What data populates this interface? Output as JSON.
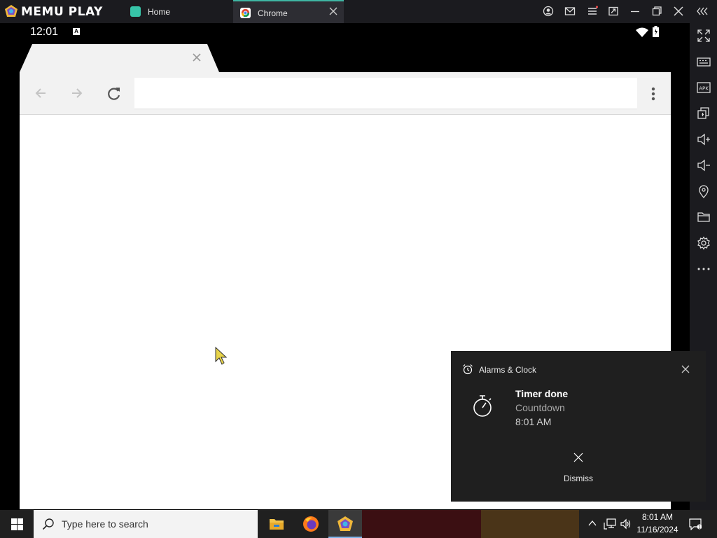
{
  "emulator": {
    "brand": "MEMU PLAY",
    "tabs": [
      {
        "label": "Home"
      },
      {
        "label": "Chrome"
      }
    ]
  },
  "android": {
    "clock": "12:01",
    "badge": "A"
  },
  "notification": {
    "app": "Alarms & Clock",
    "title": "Timer done",
    "subtitle": "Countdown",
    "time": "8:01 AM",
    "dismiss_label": "Dismiss"
  },
  "taskbar": {
    "search_placeholder": "Type here to search",
    "time": "8:01 AM",
    "date": "11/16/2024"
  }
}
